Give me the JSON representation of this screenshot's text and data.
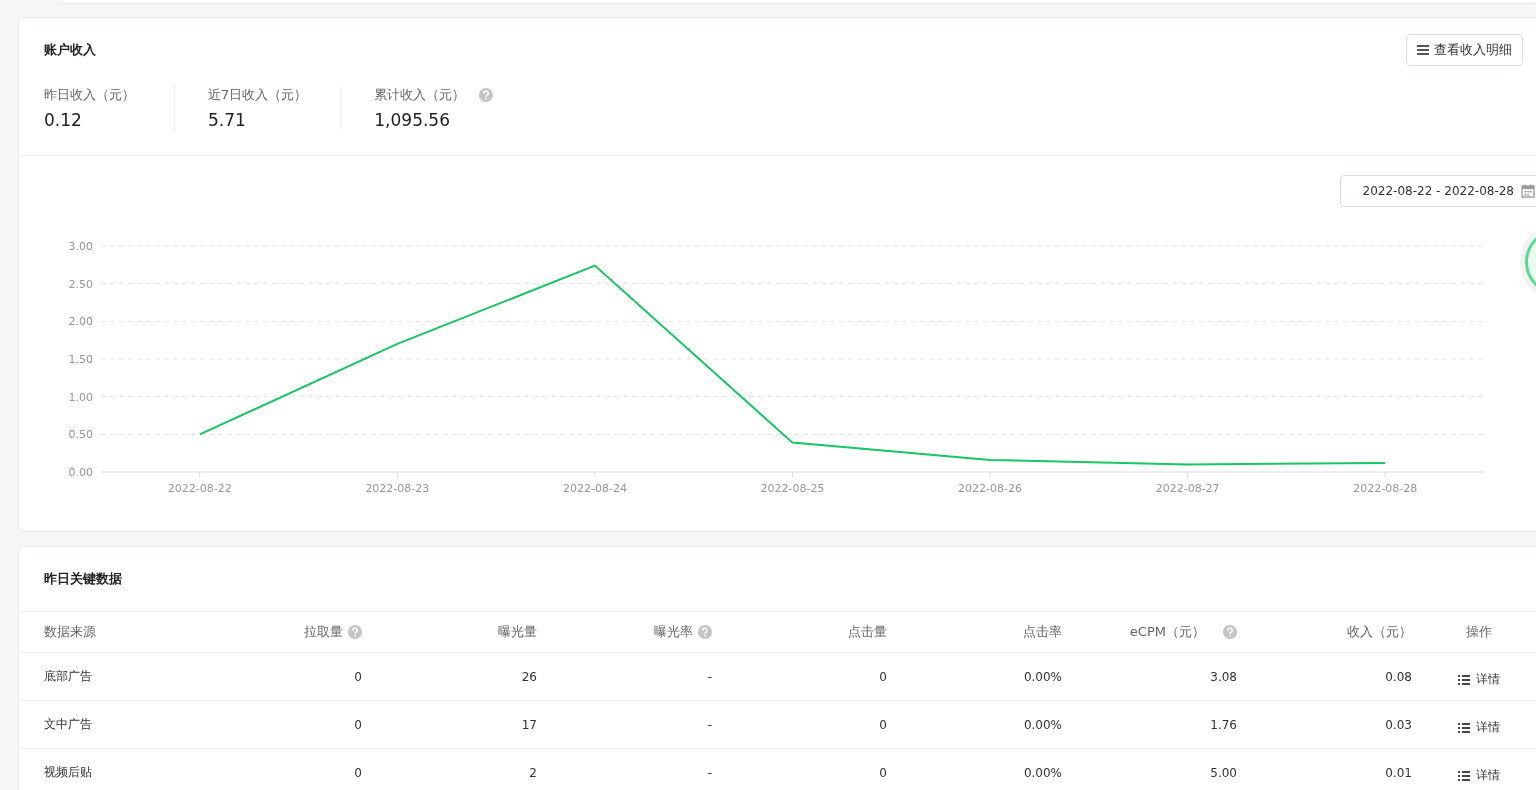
{
  "income_card": {
    "title": "账户收入",
    "detail_button": "查看收入明细",
    "stats": [
      {
        "label": "昨日收入（元）",
        "value": "0.12",
        "help": false
      },
      {
        "label": "近7日收入（元）",
        "value": "5.71",
        "help": false
      },
      {
        "label": "累计收入（元）",
        "value": "1,095.56",
        "help": true
      }
    ],
    "date_range": "2022-08-22 - 2022-08-28",
    "chart_data": {
      "type": "line",
      "categories": [
        "2022-08-22",
        "2022-08-23",
        "2022-08-24",
        "2022-08-25",
        "2022-08-26",
        "2022-08-27",
        "2022-08-28"
      ],
      "grid": true,
      "series": [
        {
          "color": "#19c565",
          "values": [
            0.5,
            1.7,
            2.74,
            0.39,
            0.16,
            0.1,
            0.12
          ]
        }
      ],
      "ylim": [
        0,
        3
      ],
      "yticks": [
        {
          "value": 0,
          "label": "0.00"
        },
        {
          "value": 0.5,
          "label": "0.50"
        },
        {
          "value": 1,
          "label": "1.00"
        },
        {
          "value": 1.5,
          "label": "1.50"
        },
        {
          "value": 2,
          "label": "2.00"
        },
        {
          "value": 2.5,
          "label": "2.50"
        },
        {
          "value": 3,
          "label": "3.00"
        }
      ]
    }
  },
  "key_data_card": {
    "title": "昨日关键数据",
    "columns": [
      {
        "label": "数据来源",
        "help": false
      },
      {
        "label": "拉取量",
        "help": true
      },
      {
        "label": "曝光量",
        "help": false
      },
      {
        "label": "曝光率",
        "help": true
      },
      {
        "label": "点击量",
        "help": false
      },
      {
        "label": "点击率",
        "help": false
      },
      {
        "label": "eCPM（元）",
        "help": true
      },
      {
        "label": "收入（元）",
        "help": false
      },
      {
        "label": "操作",
        "help": false
      }
    ],
    "rows": [
      {
        "cells": [
          "底部广告",
          "0",
          "26",
          "-",
          "0",
          "0.00%",
          "3.08",
          "0.08"
        ],
        "action": "详情"
      },
      {
        "cells": [
          "文中广告",
          "0",
          "17",
          "-",
          "0",
          "0.00%",
          "1.76",
          "0.03"
        ],
        "action": "详情"
      },
      {
        "cells": [
          "视频后贴",
          "0",
          "2",
          "-",
          "0",
          "0.00%",
          "5.00",
          "0.01"
        ],
        "action": "详情"
      }
    ]
  }
}
